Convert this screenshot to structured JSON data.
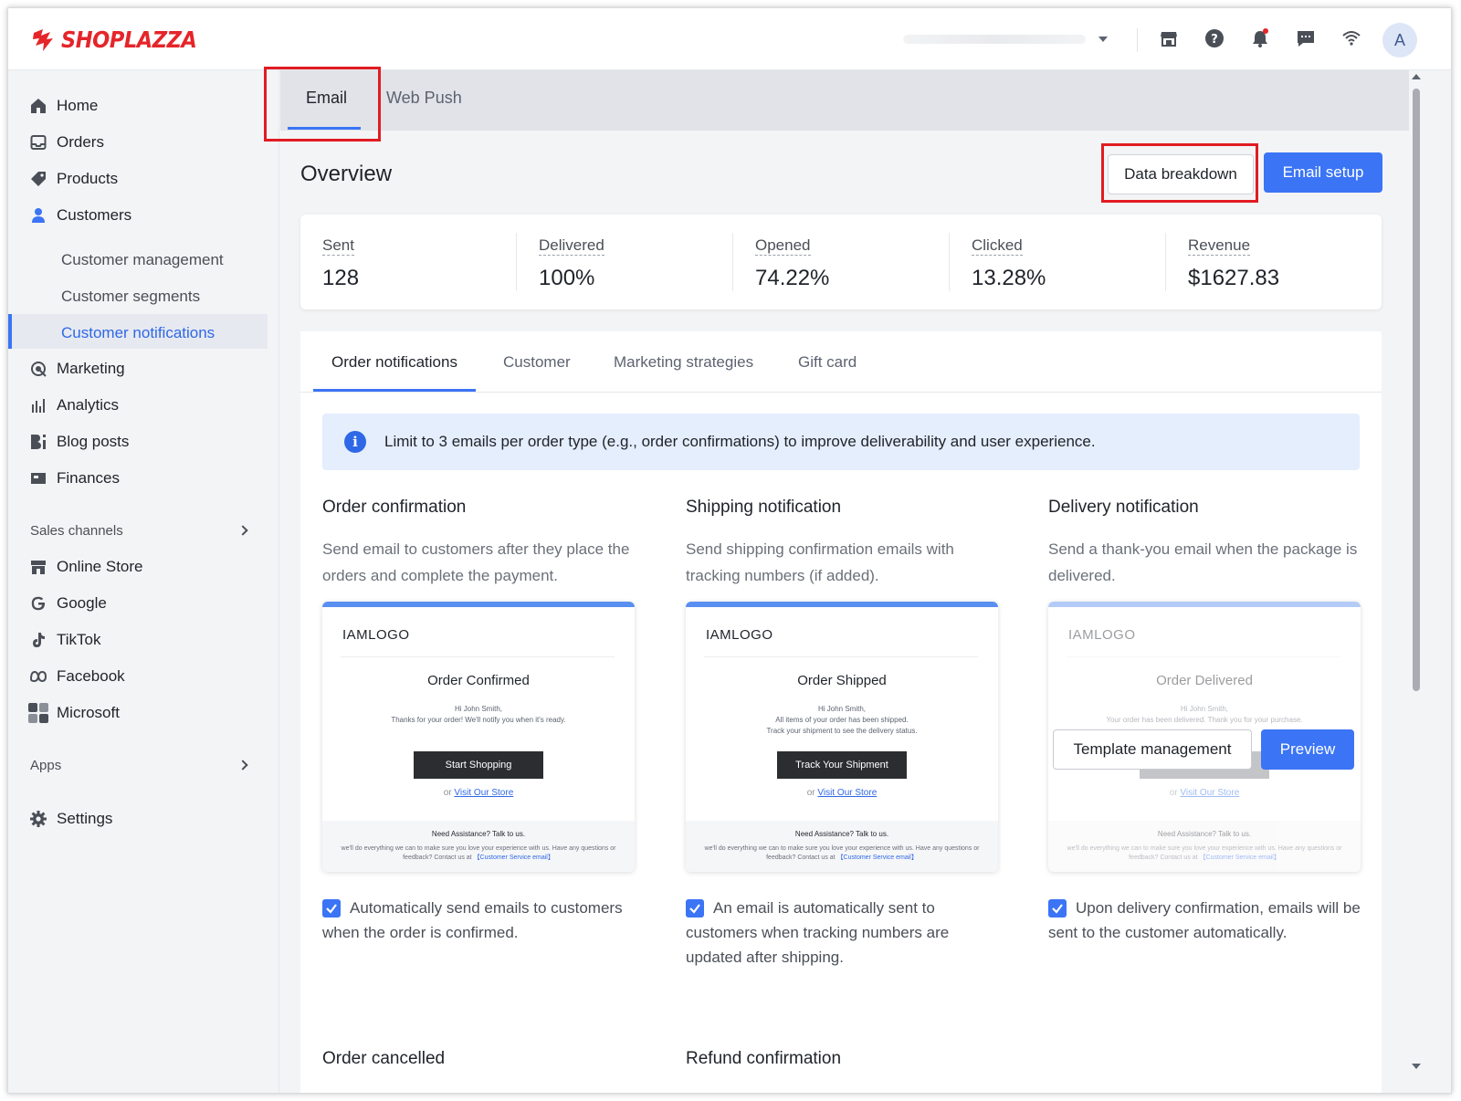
{
  "brand": {
    "name": "SHOPLAZZA",
    "color": "#e5252a"
  },
  "header": {
    "icons": [
      "store-icon",
      "help-icon",
      "bell-icon",
      "chat-icon",
      "wifi-icon"
    ],
    "avatar_initial": "A"
  },
  "sidebar": {
    "items": [
      {
        "label": "Home",
        "icon": "home-icon"
      },
      {
        "label": "Orders",
        "icon": "orders-icon"
      },
      {
        "label": "Products",
        "icon": "tag-icon"
      },
      {
        "label": "Customers",
        "icon": "person-icon"
      },
      {
        "label": "Marketing",
        "icon": "marketing-icon"
      },
      {
        "label": "Analytics",
        "icon": "analytics-icon"
      },
      {
        "label": "Blog posts",
        "icon": "blog-icon"
      },
      {
        "label": "Finances",
        "icon": "finances-icon"
      }
    ],
    "customer_sub": [
      "Customer management",
      "Customer segments",
      "Customer notifications"
    ],
    "sales_channels_label": "Sales channels",
    "channels": [
      {
        "label": "Online Store",
        "icon": "store-icon"
      },
      {
        "label": "Google",
        "icon": "google-icon"
      },
      {
        "label": "TikTok",
        "icon": "tiktok-icon"
      },
      {
        "label": "Facebook",
        "icon": "meta-icon"
      },
      {
        "label": "Microsoft",
        "icon": "microsoft-icon"
      }
    ],
    "apps_label": "Apps",
    "settings_label": "Settings"
  },
  "tabs": {
    "email": "Email",
    "web_push": "Web Push"
  },
  "overview": {
    "title": "Overview",
    "data_breakdown": "Data breakdown",
    "email_setup": "Email setup",
    "stats": [
      {
        "label": "Sent",
        "value": "128"
      },
      {
        "label": "Delivered",
        "value": "100%"
      },
      {
        "label": "Opened",
        "value": "74.22%"
      },
      {
        "label": "Clicked",
        "value": "13.28%"
      },
      {
        "label": "Revenue",
        "value": "$1627.83"
      }
    ]
  },
  "subtabs": [
    "Order notifications",
    "Customer",
    "Marketing strategies",
    "Gift card"
  ],
  "info_banner": "Limit to 3 emails per order type (e.g., order confirmations) to improve deliverability and user experience.",
  "notifications": [
    {
      "title": "Order confirmation",
      "desc": "Send email to customers after they place the orders and complete the payment.",
      "tpl_logo": "IAMLOGO",
      "tpl_heading": "Order Confirmed",
      "tpl_line1": "Hi John Smith,",
      "tpl_line2": "Thanks for your order! We'll notify you when it's ready.",
      "tpl_line3": "",
      "tpl_button": "Start Shopping",
      "tpl_or": "or",
      "tpl_link": "Visit Our Store",
      "tpl_footer_h": "Need Assistance? Talk to us.",
      "tpl_footer_p": "we'll do everything we can to make sure you love your experience with us. Have any questions or feedback? Contact us at",
      "tpl_footer_link": "【Customer Service email】",
      "auto_text": "Automatically send emails to customers when the order is confirmed."
    },
    {
      "title": "Shipping notification",
      "desc": "Send shipping confirmation emails with tracking numbers (if added).",
      "tpl_logo": "IAMLOGO",
      "tpl_heading": "Order Shipped",
      "tpl_line1": "Hi John Smith,",
      "tpl_line2": "All items of your order has been shipped.",
      "tpl_line3": "Track your shipment to see the delivery status.",
      "tpl_button": "Track Your Shipment",
      "tpl_or": "or",
      "tpl_link": "Visit Our Store",
      "tpl_footer_h": "Need Assistance? Talk to us.",
      "tpl_footer_p": "we'll do everything we can to make sure you love your experience with us. Have any questions or feedback? Contact us at",
      "tpl_footer_link": "【Customer Service email】",
      "auto_text": "An email is automatically sent to customers when tracking numbers are updated after shipping."
    },
    {
      "title": "Delivery notification",
      "desc": "Send a thank-you email when the package is delivered.",
      "tpl_logo": "IAMLOGO",
      "tpl_heading": "Order Delivered",
      "tpl_line1": "Hi John Smith,",
      "tpl_line2": "Your order has been delivered. Thank you for your purchase.",
      "tpl_line3": "",
      "tpl_button": "",
      "tpl_or": "or",
      "tpl_link": "Visit Our Store",
      "tpl_footer_h": "Need Assistance? Talk to us.",
      "tpl_footer_p": "we'll do everything we can to make sure you love your experience with us. Have any questions or feedback? Contact us at",
      "tpl_footer_link": "【Customer Service email】",
      "auto_text": "Upon delivery confirmation, emails will be sent to the customer automatically."
    }
  ],
  "hover_actions": {
    "template_management": "Template management",
    "preview": "Preview"
  },
  "more_notifications": [
    "Order cancelled",
    "Refund confirmation"
  ],
  "colors": {
    "accent": "#3b74f5",
    "highlight_box": "#e11b22",
    "info_bg": "#e5eefd"
  }
}
